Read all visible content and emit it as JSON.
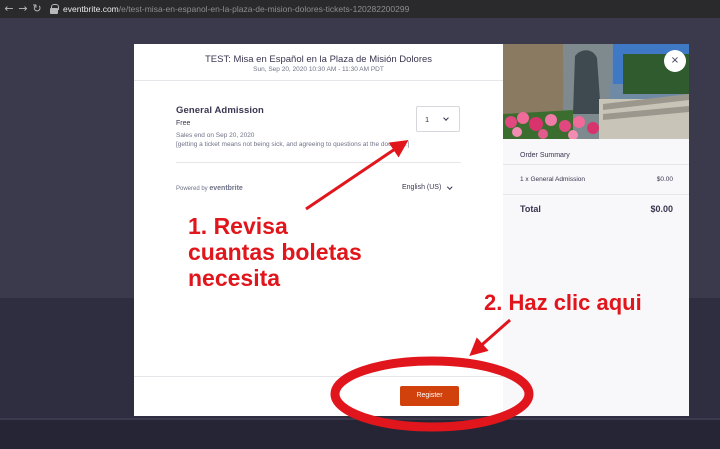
{
  "browser": {
    "back_icon": "arrow-left-icon",
    "forward_icon": "arrow-right-icon",
    "reload_icon": "reload-icon",
    "url_domain": "eventbrite.com",
    "url_path": "/e/test-misa-en-espanol-en-la-plaza-de-mision-dolores-tickets-120282200299"
  },
  "modal": {
    "event_title": "TEST: Misa en Español en la Plaza de Misión Dolores",
    "event_datetime": "Sun, Sep 20, 2020 10:30 AM - 11:30 AM PDT",
    "ticket": {
      "name": "General Admission",
      "price": "Free",
      "sales_end": "Sales end on Sep 20, 2020",
      "description": "[getting a ticket means not being sick, and agreeing to questions at the door, etc.]",
      "quantity": "1"
    },
    "powered_by_label": "Powered by",
    "powered_by_brand": "eventbrite",
    "language": "English (US)",
    "register_label": "Register",
    "close_symbol": "×"
  },
  "order_summary": {
    "title": "Order Summary",
    "item_label": "1 x General Admission",
    "item_price": "$0.00",
    "total_label": "Total",
    "total_value": "$0.00"
  },
  "annotations": {
    "step1_line1": "1. Revisa",
    "step1_line2": "cuantas boletas",
    "step1_line3": "necesita",
    "step2": "2. Haz clic aqui",
    "color": "#e1161c"
  },
  "colors": {
    "brand_orange": "#d1410c",
    "text_dark": "#39364f",
    "overlay": "#3b3a4c"
  }
}
